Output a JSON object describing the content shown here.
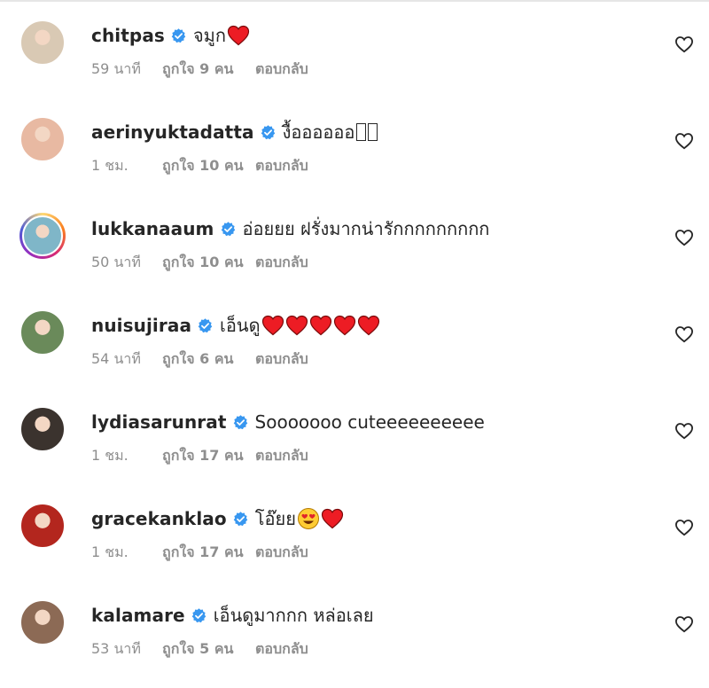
{
  "colors": {
    "verified": "#3897f0",
    "heart": "#ed1c24",
    "meta_text": "#8e8e8e",
    "text": "#262626"
  },
  "comments": [
    {
      "username": "chitpas",
      "text": "จมูก",
      "emojis": [
        "red-heart"
      ],
      "time": "59 นาที",
      "likes": "ถูกใจ 9 คน",
      "reply": "ตอบกลับ",
      "avatar_color": "#d9c9b4"
    },
    {
      "username": "aerinyuktadatta",
      "text": "งื้ออออออ",
      "emojis": [
        "missing-glyph",
        "missing-glyph"
      ],
      "time": "1 ชม.",
      "likes": "ถูกใจ 10 คน",
      "reply": "ตอบกลับ",
      "avatar_color": "#e8b9a2"
    },
    {
      "username": "lukkanaaum",
      "text": "อ่อยยย ฝรั่งมากน่ารักกกกกกกกก",
      "emojis": [],
      "time": "50 นาที",
      "likes": "ถูกใจ 10 คน",
      "reply": "ตอบกลับ",
      "avatar_color": "#7fb6c8",
      "story_ring": true
    },
    {
      "username": "nuisujiraa",
      "text": "เอ็นดู",
      "emojis": [
        "red-heart",
        "red-heart",
        "red-heart",
        "red-heart",
        "red-heart"
      ],
      "time": "54 นาที",
      "likes": "ถูกใจ 6 คน",
      "reply": "ตอบกลับ",
      "avatar_color": "#6a8a5a"
    },
    {
      "username": "lydiasarunrat",
      "text": "Sooooooo cuteeeeeeeeee",
      "emojis": [],
      "time": "1 ชม.",
      "likes": "ถูกใจ 17 คน",
      "reply": "ตอบกลับ",
      "avatar_color": "#3b332e"
    },
    {
      "username": "gracekanklao",
      "text": "โอ๊ยย",
      "emojis": [
        "smiling-face-with-heart-eyes",
        "red-heart"
      ],
      "time": "1 ชม.",
      "likes": "ถูกใจ 17 คน",
      "reply": "ตอบกลับ",
      "avatar_color": "#b3261e"
    },
    {
      "username": "kalamare",
      "text": "เอ็นดูมากกก หล่อเลย",
      "emojis": [],
      "time": "53 นาที",
      "likes": "ถูกใจ 5 คน",
      "reply": "ตอบกลับ",
      "avatar_color": "#8c6a55"
    }
  ]
}
